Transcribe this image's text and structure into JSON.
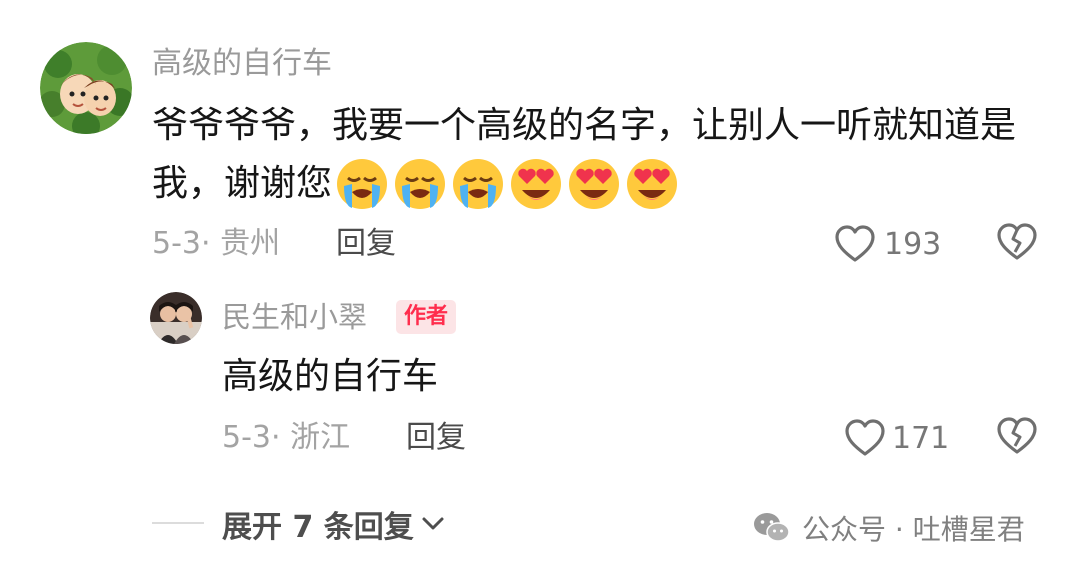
{
  "comment": {
    "username": "高级的自行车",
    "text_line1": "爷爷爷爷，我要一个高级的名字，让别人一听就知道是",
    "text_line2": "我，谢谢您",
    "emojis": [
      "loudly-crying-face",
      "loudly-crying-face",
      "loudly-crying-face",
      "smiling-face-with-heart-eyes",
      "smiling-face-with-heart-eyes",
      "smiling-face-with-heart-eyes"
    ],
    "date_location": "5-3· 贵州",
    "reply_label": "回复",
    "like_count": "193"
  },
  "reply": {
    "username": "民生和小翠",
    "badge": "作者",
    "text": "高级的自行车",
    "date_location": "5-3· 浙江",
    "reply_label": "回复",
    "like_count": "171"
  },
  "expand": {
    "label": "展开 7 条回复"
  },
  "watermark": {
    "text": "公众号 · 吐槽星君"
  },
  "colors": {
    "badge_text": "#ff2d4d",
    "badge_bg": "#fce4e6",
    "meta": "#a3a3a3"
  },
  "icons": {
    "like": "heart-outline-icon",
    "dislike": "broken-heart-icon",
    "expand": "chevron-down-icon",
    "watermark": "wechat-icon"
  }
}
